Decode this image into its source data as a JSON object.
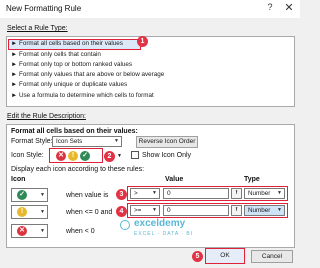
{
  "window": {
    "title": "New Formatting Rule",
    "help": "?",
    "close": "✕"
  },
  "rule_type": {
    "label": "Select a Rule Type:",
    "items": [
      "► Format all cells based on their values",
      "► Format only cells that contain",
      "► Format only top or bottom ranked values",
      "► Format only values that are above or below average",
      "► Format only unique or duplicate values",
      "► Use a formula to determine which cells to format"
    ]
  },
  "description": {
    "label": "Edit the Rule Description:",
    "heading": "Format all cells based on their values:",
    "format_style_label": "Format Style:",
    "format_style_value": "Icon Sets",
    "reverse_button": "Reverse Icon Order",
    "icon_style_label": "Icon Style:",
    "show_icon_only": "Show Icon Only",
    "display_text": "Display each icon according to these rules:",
    "columns": {
      "icon": "Icon",
      "value": "Value",
      "type": "Type"
    },
    "rows": [
      {
        "condition": "when value is",
        "operator": ">",
        "value": "0",
        "type": "Number"
      },
      {
        "condition": "when <= 0 and",
        "operator": ">=",
        "value": "0",
        "type": "Number"
      },
      {
        "condition": "when < 0",
        "operator": "",
        "value": "",
        "type": ""
      }
    ]
  },
  "badges": [
    "1",
    "2",
    "3",
    "4",
    "5"
  ],
  "watermark": {
    "name": "exceldemy",
    "tagline": "EXCEL · DATA · BI"
  },
  "buttons": {
    "ok": "OK",
    "cancel": "Cancel"
  },
  "colors": {
    "highlight": "#e0213b",
    "red_icon": "#d9343f",
    "yellow_icon": "#e8b82a",
    "green_icon": "#2f8a57"
  }
}
